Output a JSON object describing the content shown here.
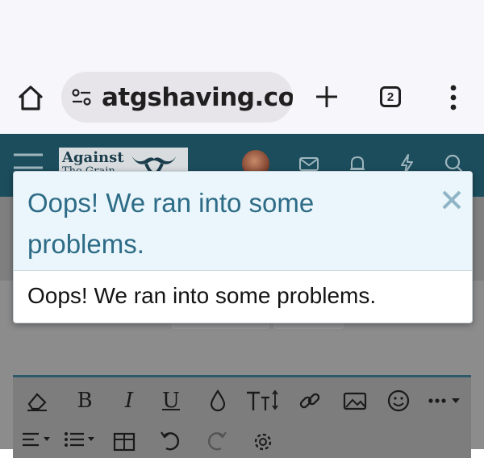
{
  "browser": {
    "url": "atgshaving.com",
    "tab_count": "2"
  },
  "site": {
    "logo_text": "Against",
    "logo_subtext": "The Grain"
  },
  "modal": {
    "title": "Oops! We ran into some problems.",
    "message": "Oops! We ran into some problems."
  },
  "editor": {
    "bold_label": "B",
    "italic_label": "I",
    "underline_label": "U"
  },
  "colors": {
    "header": "#1c4d5d",
    "modal_title": "#2d6b86",
    "modal_header_bg": "#eaf6fb"
  }
}
